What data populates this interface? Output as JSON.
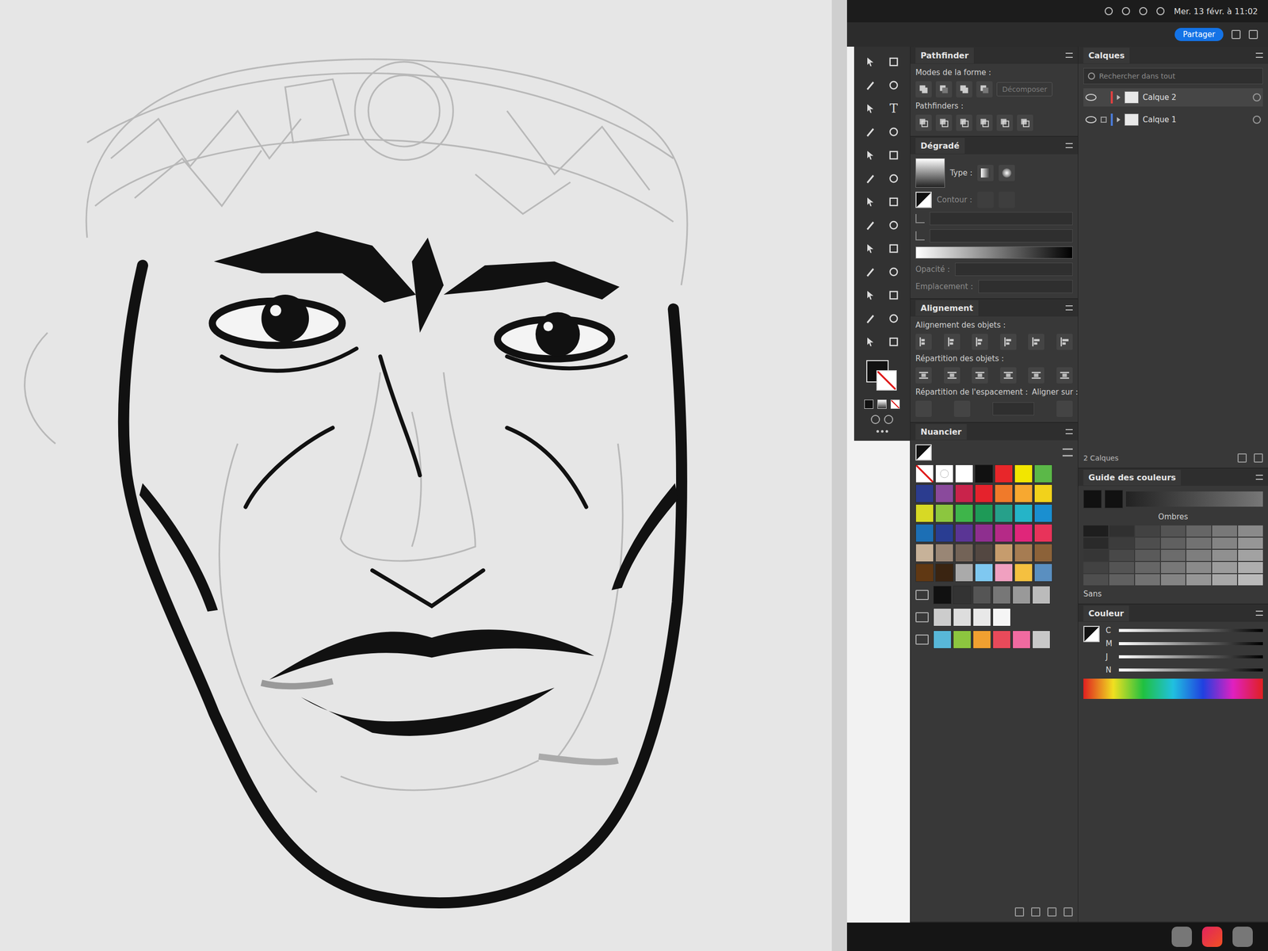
{
  "menubar": {
    "clock": "Mer. 13 févr. à 11:02",
    "share_button": "Partager"
  },
  "toolbar": {
    "type_tool_label": "T",
    "fill_color": "#111111",
    "stroke_none": true
  },
  "pathfinder": {
    "title": "Pathfinder",
    "shape_modes_label": "Modes de la forme :",
    "pathfinders_label": "Pathfinders :",
    "expand_button": {
      "label": "Décomposer",
      "disabled": true
    }
  },
  "gradient": {
    "title": "Dégradé",
    "type_label": "Type :",
    "stroke_label": "Contour :",
    "opacity_label": "Opacité :",
    "location_label": "Emplacement :"
  },
  "align": {
    "title": "Alignement",
    "align_objects_label": "Alignement des objets :",
    "distribute_objects_label": "Répartition des objets :",
    "distribute_spacing_label": "Répartition de l'espacement :",
    "align_to_label": "Aligner sur :"
  },
  "swatches": {
    "title": "Nuancier",
    "items": [
      {
        "kind": "none",
        "color": "#ffffff"
      },
      {
        "kind": "registration",
        "color": "#ffffff"
      },
      {
        "kind": "color",
        "color": "#ffffff"
      },
      {
        "kind": "color",
        "color": "#111111"
      },
      {
        "kind": "color",
        "color": "#e8262a"
      },
      {
        "kind": "color",
        "color": "#f2e600"
      },
      {
        "kind": "color",
        "color": "#5bb848"
      },
      {
        "kind": "color",
        "color": "#2b3c8f"
      },
      {
        "kind": "color",
        "color": "#8a4a9c"
      },
      {
        "kind": "color",
        "color": "#c9234b"
      },
      {
        "kind": "color",
        "color": "#e5222c"
      },
      {
        "kind": "color",
        "color": "#f07a2a"
      },
      {
        "kind": "color",
        "color": "#f7a830"
      },
      {
        "kind": "color",
        "color": "#f2d21b"
      },
      {
        "kind": "color",
        "color": "#d7d925"
      },
      {
        "kind": "color",
        "color": "#8cc63f"
      },
      {
        "kind": "color",
        "color": "#3eb54a"
      },
      {
        "kind": "color",
        "color": "#1e9a57"
      },
      {
        "kind": "color",
        "color": "#26a08a"
      },
      {
        "kind": "color",
        "color": "#25b4c8"
      },
      {
        "kind": "color",
        "color": "#1a8fd0"
      },
      {
        "kind": "color",
        "color": "#1c6fb5"
      },
      {
        "kind": "color",
        "color": "#293d92"
      },
      {
        "kind": "color",
        "color": "#5a3595"
      },
      {
        "kind": "color",
        "color": "#8e2f8f"
      },
      {
        "kind": "color",
        "color": "#b52a87"
      },
      {
        "kind": "color",
        "color": "#e0267a"
      },
      {
        "kind": "color",
        "color": "#e8335a"
      },
      {
        "kind": "color",
        "color": "#c7b299"
      },
      {
        "kind": "color",
        "color": "#998675"
      },
      {
        "kind": "color",
        "color": "#736357"
      },
      {
        "kind": "color",
        "color": "#534741"
      },
      {
        "kind": "color",
        "color": "#c69c6d"
      },
      {
        "kind": "color",
        "color": "#a67c52"
      },
      {
        "kind": "color",
        "color": "#8c6239"
      },
      {
        "kind": "color",
        "color": "#603813"
      },
      {
        "kind": "color",
        "color": "#3a2411"
      },
      {
        "kind": "color",
        "color": "#aaaaaa"
      },
      {
        "kind": "color",
        "color": "#7fc8f0"
      },
      {
        "kind": "color",
        "color": "#f0a0c0"
      },
      {
        "kind": "color",
        "color": "#f5c040"
      },
      {
        "kind": "color",
        "color": "#5a8fc0"
      }
    ],
    "groups": [
      {
        "colors": [
          "#111111",
          "#333333",
          "#555555",
          "#777777",
          "#999999",
          "#bbbbbb"
        ]
      },
      {
        "colors": [
          "#cccccc",
          "#dddddd",
          "#e8e8e8",
          "#f5f5f5"
        ]
      },
      {
        "colors": [
          "#58b7d8",
          "#8cc63f",
          "#f0a030",
          "#e84a5a",
          "#f06aa0",
          "#c8c8c8"
        ]
      }
    ]
  },
  "layers": {
    "title": "Calques",
    "search_placeholder": "Rechercher dans tout",
    "count": "2 Calques",
    "items": [
      {
        "name": "Calque 2",
        "selected": true,
        "visible": true,
        "locked": false,
        "color": "#e04040"
      },
      {
        "name": "Calque 1",
        "selected": false,
        "visible": true,
        "locked": true,
        "color": "#4a7bd6"
      }
    ]
  },
  "color_guide": {
    "title": "Guide des couleurs",
    "variation": "Ombres",
    "none_label": "Sans"
  },
  "color": {
    "title": "Couleur",
    "channels": [
      "C",
      "M",
      "J",
      "N"
    ]
  }
}
